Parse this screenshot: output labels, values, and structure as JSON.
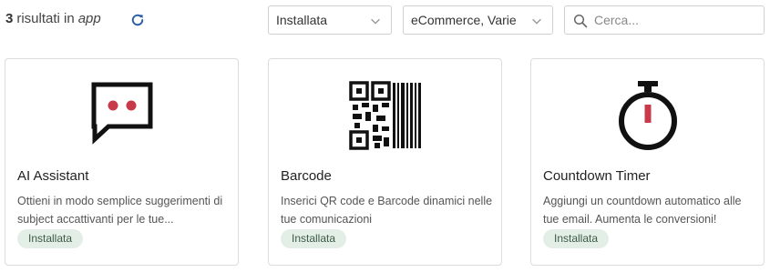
{
  "header": {
    "results_count": "3",
    "results_text": "risultati in",
    "results_scope": "app"
  },
  "filters": {
    "status_value": "Installata",
    "category_value": "eCommerce, Varie"
  },
  "search": {
    "placeholder": "Cerca..."
  },
  "icons": {
    "refresh": "refresh-icon",
    "chevron": "chevron-down-icon",
    "search": "search-icon"
  },
  "colors": {
    "accent": "#2a5fa8",
    "badge_bg": "#e3efe6",
    "icon_red": "#c8394a"
  },
  "apps": [
    {
      "title": "AI Assistant",
      "description": "Ottieni in modo semplice suggerimenti di subject accattivanti per le tue...",
      "badge": "Installata",
      "icon": "chat-bubble-icon"
    },
    {
      "title": "Barcode",
      "description": "Inserici QR code e Barcode dinamici nelle tue comunicazioni",
      "badge": "Installata",
      "icon": "qr-barcode-icon"
    },
    {
      "title": "Countdown Timer",
      "description": "Aggiungi un countdown automatico alle tue email. Aumenta le conversioni!",
      "badge": "Installata",
      "icon": "stopwatch-icon"
    }
  ]
}
